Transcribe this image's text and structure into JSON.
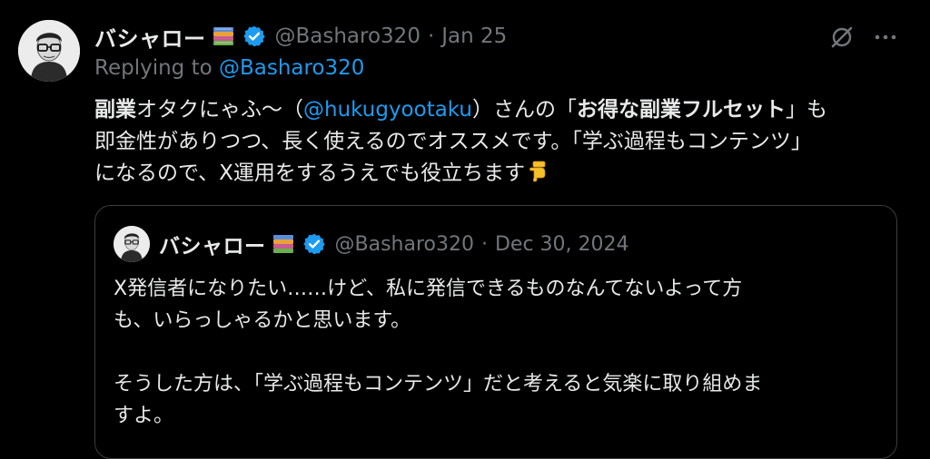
{
  "tweet": {
    "author": {
      "display_name": "バシャロー",
      "handle": "@Basharo320",
      "avatar": "avatar-portrait-glasses",
      "badge_emoji": "books-emoji",
      "verified_icon": "verified-badge-icon"
    },
    "separator": "·",
    "date": "Jan 25",
    "reply_prefix": "Replying to ",
    "reply_to": "@Basharo320",
    "body": {
      "l1_a": "副業",
      "l1_b": "オタクにゃふ〜（",
      "l1_mention": "@hukugyootaku",
      "l1_c": "）さんの「",
      "l1_bold": "お得な副業フルセット",
      "l1_d": "」も",
      "l2": "即金性がありつつ、長く使えるのでオススメです。「学ぶ過程もコンテンツ」",
      "l3": "になるので、X運用をするうえでも役立ちます",
      "l3_emoji": "pointing-down-emoji"
    },
    "actions": {
      "grok_icon": "grok-icon",
      "more_icon": "more-icon"
    }
  },
  "quote": {
    "author": {
      "display_name": "バシャロー",
      "handle": "@Basharo320"
    },
    "separator": "·",
    "date": "Dec 30, 2024",
    "lines": [
      "X発信者になりたい……けど、私に発信できるものなんてないよって方",
      "も、いらっしゃるかと思います。",
      "",
      "そうした方は、「学ぶ過程もコンテンツ」だと考えると気楽に取り組めま",
      "すよ。"
    ]
  },
  "colors": {
    "background": "#000000",
    "text": "#e7e9ea",
    "secondary": "#71767b",
    "link": "#1d9bf0",
    "border": "#3a3d41"
  }
}
